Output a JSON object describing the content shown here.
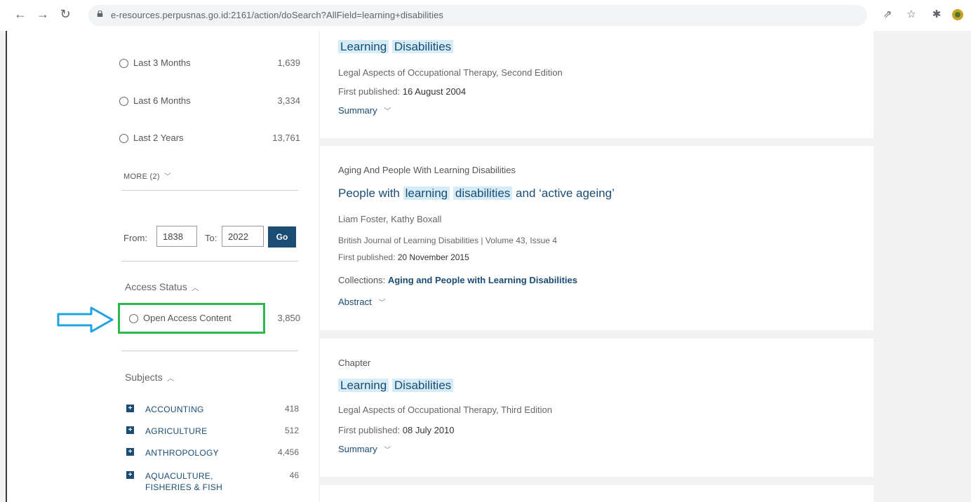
{
  "browser": {
    "url": "e-resources.perpusnas.go.id:2161/action/doSearch?AllField=learning+disabilities"
  },
  "sidebar": {
    "date_filters": [
      {
        "label": "Last 3 Months",
        "count": "1,639"
      },
      {
        "label": "Last 6 Months",
        "count": "3,334"
      },
      {
        "label": "Last 2 Years",
        "count": "13,761"
      }
    ],
    "more_label": "MORE (2)",
    "range": {
      "from_label": "From:",
      "from_value": "1838",
      "to_label": "To:",
      "to_value": "2022",
      "go_label": "Go"
    },
    "access_status": {
      "heading": "Access Status",
      "label": "Open Access Content",
      "count": "3,850"
    },
    "subjects": {
      "heading": "Subjects",
      "items": [
        {
          "label": "ACCOUNTING",
          "count": "418"
        },
        {
          "label": "AGRICULTURE",
          "count": "512"
        },
        {
          "label": "ANTHROPOLOGY",
          "count": "4,456"
        },
        {
          "label": "AQUACULTURE, FISHERIES & FISH",
          "count": "46"
        }
      ]
    }
  },
  "results": [
    {
      "title_parts": [
        "Learning",
        "Disabilities"
      ],
      "source": "Legal Aspects of Occupational Therapy, Second Edition",
      "published_label": "First published:",
      "published_date": "16 August 2004",
      "toggle": "Summary"
    },
    {
      "kicker": "Aging And People With Learning Disabilities",
      "title_pre": "People with",
      "title_hl1": "learning",
      "title_hl2": "disabilities",
      "title_post": "and ‘active ageing’",
      "authors": "Liam Foster, Kathy Boxall",
      "journal": "British Journal of Learning Disabilities | Volume 43, Issue 4",
      "published_label": "First published:",
      "published_date": "20 November 2015",
      "collections_label": "Collections:",
      "collections_value": "Aging and People with Learning Disabilities",
      "toggle": "Abstract"
    },
    {
      "kicker": "Chapter",
      "title_parts": [
        "Learning",
        "Disabilities"
      ],
      "source": "Legal Aspects of Occupational Therapy, Third Edition",
      "published_label": "First published:",
      "published_date": "08 July 2010",
      "toggle": "Summary"
    }
  ],
  "colors": {
    "accent": "#1a4c74",
    "highlight": "#d5ecf7",
    "annotation_box": "#2db84a",
    "annotation_arrow": "#1fa3e0"
  },
  "icons": [
    "back-arrow-icon",
    "forward-arrow-icon",
    "reload-icon",
    "lock-icon",
    "share-icon",
    "star-icon",
    "puzzle-icon",
    "profile-avatar-icon",
    "chevron-down-icon",
    "chevron-up-icon",
    "plus-square-icon",
    "annotation-arrow-icon"
  ]
}
